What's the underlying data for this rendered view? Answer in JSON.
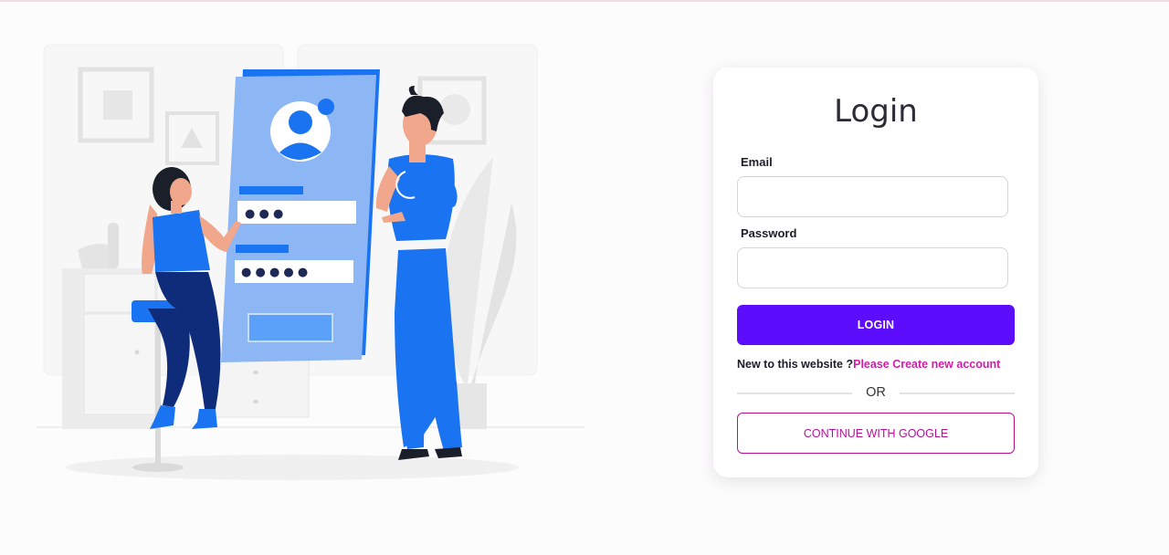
{
  "login": {
    "title": "Login",
    "email_label": "Email",
    "email_value": "",
    "password_label": "Password",
    "password_value": "",
    "login_button": "LOGIN",
    "new_user_text": "New to this website ?",
    "create_account_link": "Please Create new account",
    "divider_text": "OR",
    "google_button": "CONTINUE WITH GOOGLE"
  },
  "illustration": {
    "name": "login-illustration",
    "mask_short": "● ● ●",
    "mask_long": "● ● ● ● ●"
  },
  "colors": {
    "primary": "#5b0dfc",
    "accent": "#d21ba8",
    "illustration_blue": "#1a73f0"
  }
}
